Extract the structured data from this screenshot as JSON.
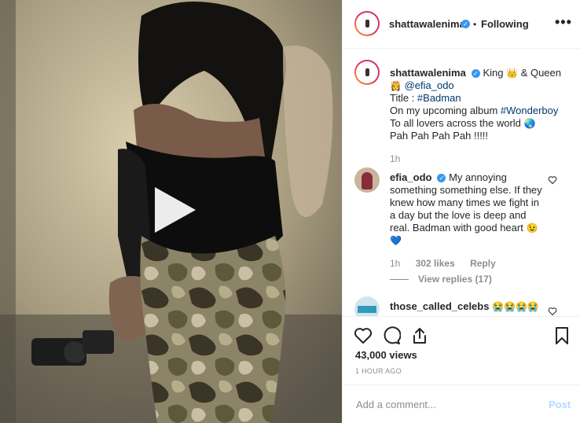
{
  "header": {
    "username": "shattawalenima",
    "separator": "•",
    "follow_label": "Following",
    "more_icon": "ellipsis-icon",
    "more_label": "•••"
  },
  "caption": {
    "username": "shattawalenima",
    "text_1": "King",
    "emoji_crown": "👑",
    "text_2": "& Queen",
    "emoji_princess": "👸",
    "mention": "@efia_odo",
    "line_title": "Title : ",
    "hashtag_title": "#Badman",
    "line_album": "On my upcoming album ",
    "hashtag_album": "#Wonderboy",
    "line_lovers": "To all lovers across the world ",
    "emoji_globe": "🌏",
    "line_pah": "Pah Pah Pah Pah !!!!!",
    "time": "1h"
  },
  "comments": [
    {
      "username": "efia_odo",
      "text": "My annoying something something else. If they knew how many times we fight in a day but the love is deep and real. Badman with good heart",
      "emoji_1": "😉",
      "emoji_2": "💙",
      "time": "1h",
      "likes": "302 likes",
      "reply_label": "Reply",
      "view_replies": "View replies (17)"
    },
    {
      "username": "those_called_celebs",
      "emojis": "😭😭😭😭"
    }
  ],
  "actions": {
    "like_icon": "heart-icon",
    "comment_icon": "comment-icon",
    "share_icon": "share-icon",
    "save_icon": "bookmark-icon"
  },
  "views": "43,000 views",
  "posted_ago": "1 HOUR AGO",
  "add_comment": {
    "placeholder": "Add a comment...",
    "post_label": "Post"
  },
  "colors": {
    "link": "#00376b",
    "verified": "#3897f0",
    "post_disabled": "#b3dbff"
  }
}
